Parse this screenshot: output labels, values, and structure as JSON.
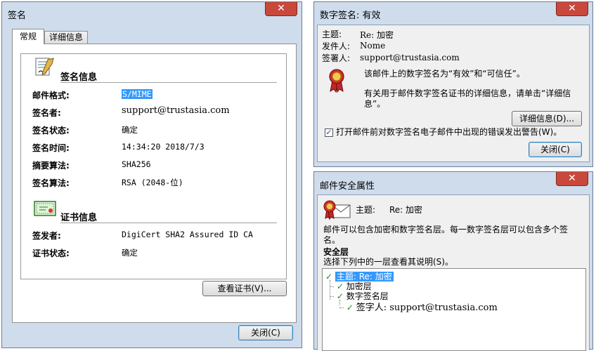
{
  "sig_window": {
    "title": "签名",
    "tabs": [
      "常规",
      "详细信息"
    ],
    "sig_section_title": "签名信息",
    "rows": [
      {
        "label": "邮件格式:",
        "value": "S/MIME"
      },
      {
        "label": "签名者:",
        "value": "support@trustasia.com"
      },
      {
        "label": "签名状态:",
        "value": "确定"
      },
      {
        "label": "签名时间:",
        "value": "14:34:20 2018/7/3"
      },
      {
        "label": "摘要算法:",
        "value": "SHA256"
      },
      {
        "label": "签名算法:",
        "value": "RSA (2048-位)"
      }
    ],
    "cert_section_title": "证书信息",
    "cert_rows": [
      {
        "label": "签发者:",
        "value": "DigiCert SHA2 Assured ID CA"
      },
      {
        "label": "证书状态:",
        "value": "确定"
      }
    ],
    "view_cert_button": "查看证书(V)...",
    "close_button": "关闭(C)"
  },
  "digsig_window": {
    "title": "数字签名: 有效",
    "subject_label": "主题:",
    "subject_value": "Re: 加密",
    "from_label": "发件人:",
    "from_value": "Nome",
    "signer_label": "签署人:",
    "signer_value": "support@trustasia.com",
    "valid_text": "该邮件上的数字签名为“有效”和“可信任”。",
    "details_text": "有关用于邮件数字签名证书的详细信息，请单击“详细信息”。",
    "details_button": "详细信息(D)...",
    "warn_checkbox_label": "打开邮件前对数字签名电子邮件中出现的错误发出警告(W)。",
    "close_button": "关闭(C)"
  },
  "security_window": {
    "title": "邮件安全属性",
    "subject_label": "主题:",
    "subject_value": "Re: 加密",
    "desc": "邮件可以包含加密和数字签名层。每一数字签名层可以包含多个签名。",
    "layer_heading": "安全层",
    "select_text": "选择下列中的一层查看其说明(S)。",
    "tree": [
      "主题: Re: 加密",
      "加密层",
      "数字签名层",
      "签字人: support@trustasia.com"
    ]
  }
}
